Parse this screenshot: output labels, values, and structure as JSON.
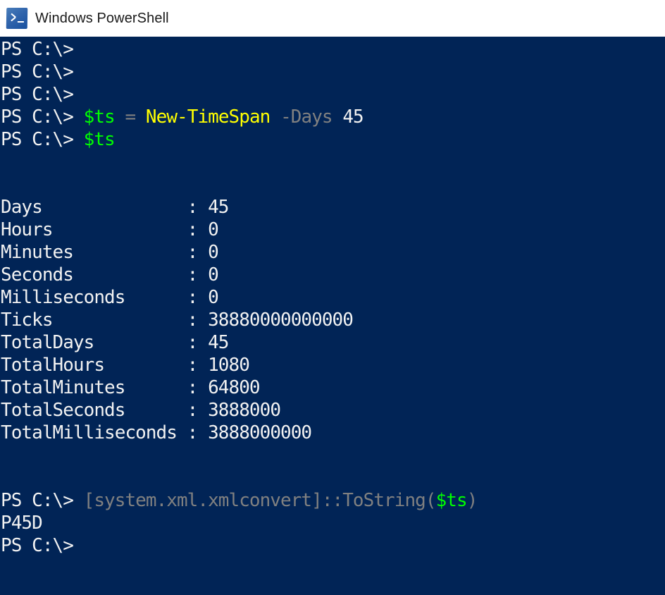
{
  "window": {
    "title": "Windows PowerShell",
    "icon": "powershell-icon",
    "titlebar_bg": "#ffffff",
    "console_bg": "#012456"
  },
  "colors": {
    "default_text": "#f2f2f2",
    "variable": "#00ff00",
    "cmdlet": "#ffff00",
    "parameter": "#808080",
    "operator": "#808080",
    "title_text": "#1a1a1a"
  },
  "console": {
    "prompt": "PS C:\\> ",
    "lines": [
      {
        "type": "prompt",
        "prompt": "PS C:\\>",
        "tokens": []
      },
      {
        "type": "prompt",
        "prompt": "PS C:\\>",
        "tokens": []
      },
      {
        "type": "prompt",
        "prompt": "PS C:\\>",
        "tokens": []
      },
      {
        "type": "command",
        "prompt": "PS C:\\> ",
        "tokens": [
          {
            "text": "$ts",
            "color": "var"
          },
          {
            "text": " ",
            "color": "default"
          },
          {
            "text": "=",
            "color": "gray"
          },
          {
            "text": " ",
            "color": "default"
          },
          {
            "text": "New-TimeSpan",
            "color": "cmd"
          },
          {
            "text": " ",
            "color": "default"
          },
          {
            "text": "-Days",
            "color": "gray"
          },
          {
            "text": " ",
            "color": "default"
          },
          {
            "text": "45",
            "color": "default"
          }
        ]
      },
      {
        "type": "command",
        "prompt": "PS C:\\> ",
        "tokens": [
          {
            "text": "$ts",
            "color": "var"
          }
        ]
      },
      {
        "type": "blank"
      },
      {
        "type": "blank"
      },
      {
        "type": "property",
        "name": "Days",
        "separator": ":",
        "value": "45"
      },
      {
        "type": "property",
        "name": "Hours",
        "separator": ":",
        "value": "0"
      },
      {
        "type": "property",
        "name": "Minutes",
        "separator": ":",
        "value": "0"
      },
      {
        "type": "property",
        "name": "Seconds",
        "separator": ":",
        "value": "0"
      },
      {
        "type": "property",
        "name": "Milliseconds",
        "separator": ":",
        "value": "0"
      },
      {
        "type": "property",
        "name": "Ticks",
        "separator": ":",
        "value": "38880000000000"
      },
      {
        "type": "property",
        "name": "TotalDays",
        "separator": ":",
        "value": "45"
      },
      {
        "type": "property",
        "name": "TotalHours",
        "separator": ":",
        "value": "1080"
      },
      {
        "type": "property",
        "name": "TotalMinutes",
        "separator": ":",
        "value": "64800"
      },
      {
        "type": "property",
        "name": "TotalSeconds",
        "separator": ":",
        "value": "3888000"
      },
      {
        "type": "property",
        "name": "TotalMilliseconds",
        "separator": ":",
        "value": "3888000000"
      },
      {
        "type": "blank"
      },
      {
        "type": "blank"
      },
      {
        "type": "command",
        "prompt": "PS C:\\> ",
        "tokens": [
          {
            "text": "[system.xml.xmlconvert]::ToString(",
            "color": "gray"
          },
          {
            "text": "$ts",
            "color": "var"
          },
          {
            "text": ")",
            "color": "gray"
          }
        ]
      },
      {
        "type": "output",
        "text": "P45D"
      },
      {
        "type": "prompt",
        "prompt": "PS C:\\>",
        "tokens": []
      }
    ],
    "property_name_width": 18
  }
}
